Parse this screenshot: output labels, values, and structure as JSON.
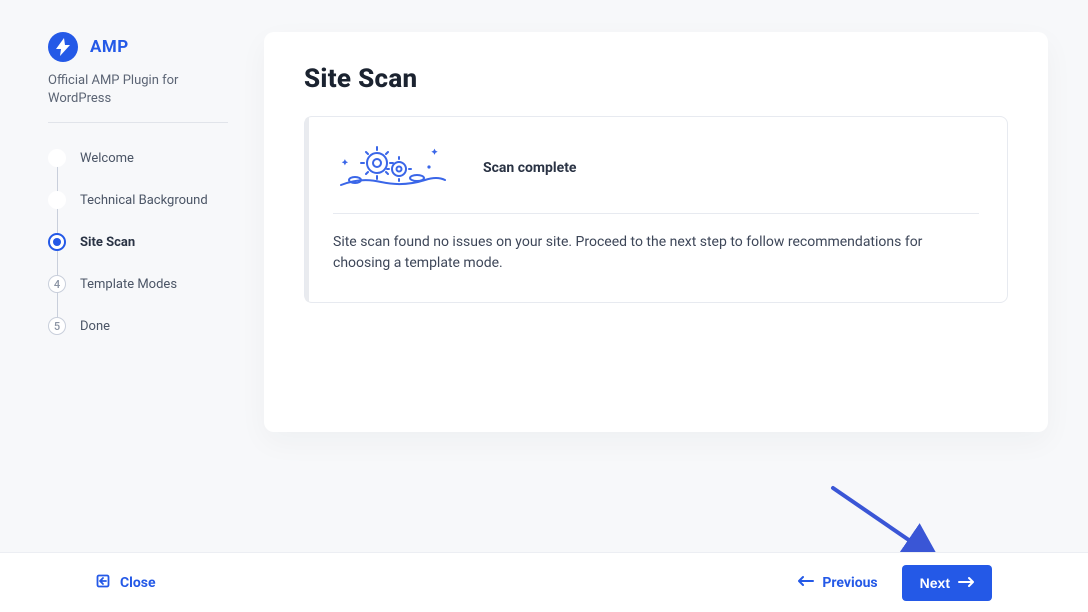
{
  "brand": {
    "name": "AMP",
    "subtitle": "Official AMP Plugin for WordPress"
  },
  "steps": [
    {
      "label": "Welcome",
      "state": "done"
    },
    {
      "label": "Technical Background",
      "state": "done"
    },
    {
      "label": "Site Scan",
      "state": "current"
    },
    {
      "label": "Template Modes",
      "state": "pending",
      "num": "4"
    },
    {
      "label": "Done",
      "state": "pending",
      "num": "5"
    }
  ],
  "page": {
    "title": "Site Scan",
    "panel_title": "Scan complete",
    "panel_body": "Site scan found no issues on your site. Proceed to the next step to follow recommendations for choosing a template mode."
  },
  "footer": {
    "close": "Close",
    "previous": "Previous",
    "next": "Next"
  }
}
